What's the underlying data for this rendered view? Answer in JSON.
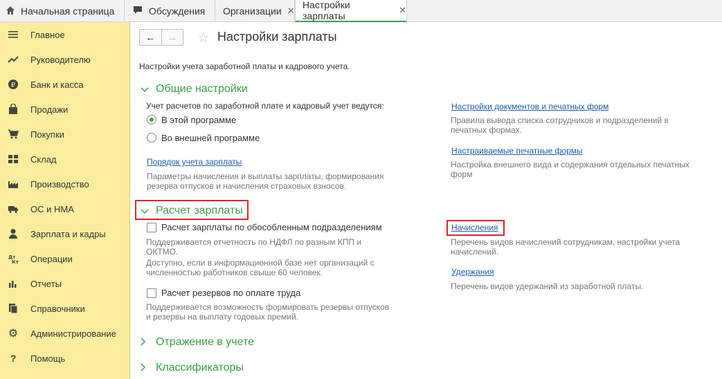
{
  "tabs": [
    {
      "label": "Начальная страница",
      "icon": "home-icon"
    },
    {
      "label": "Обсуждения",
      "icon": "chat-icon"
    },
    {
      "label": "Организации",
      "close": "✕"
    },
    {
      "label": "Настройки зарплаты",
      "close": "✕"
    }
  ],
  "sidebar": {
    "items": [
      {
        "label": "Главное",
        "icon": "menu-lines-icon"
      },
      {
        "label": "Руководителю",
        "icon": "trend-icon"
      },
      {
        "label": "Банк и касса",
        "icon": "ruble-coin-icon"
      },
      {
        "label": "Продажи",
        "icon": "shopping-bag-icon"
      },
      {
        "label": "Покупки",
        "icon": "cart-icon"
      },
      {
        "label": "Склад",
        "icon": "warehouse-grid-icon"
      },
      {
        "label": "Производство",
        "icon": "factory-icon"
      },
      {
        "label": "ОС и НМА",
        "icon": "truck-icon"
      },
      {
        "label": "Зарплата и кадры",
        "icon": "person-icon"
      },
      {
        "label": "Операции",
        "icon": "dt-kt-icon"
      },
      {
        "label": "Отчеты",
        "icon": "bar-chart-icon"
      },
      {
        "label": "Справочники",
        "icon": "books-icon"
      },
      {
        "label": "Администрирование",
        "icon": "gear-icon"
      },
      {
        "label": "Помощь",
        "icon": "question-icon"
      }
    ]
  },
  "header": {
    "title": "Настройки зарплаты",
    "back": "←",
    "forward": "→",
    "star": "☆"
  },
  "subtitle": "Настройки учета заработной платы и кадрового учета.",
  "general": {
    "title": "Общие настройки",
    "question": "Учет расчетов по заработной плате и кадровый учет ведутся:",
    "radio1": "В этой программе",
    "radio2": "Во внешней программе",
    "link1": "Порядок учета зарплаты",
    "note1a": "Параметры начисления и выплаты зарплаты, формирования",
    "note1b": "резерва отпусков и начисления страховых взносов.",
    "rlink1": "Настройки документов и печатных форм",
    "rnote1a": "Правила вывода списка сотрудников и подразделений в",
    "rnote1b": "печатных формах.",
    "rlink2": "Настраиваемые печатные формы",
    "rnote2a": "Настройка внешнего вида и содержания отдельных печатных",
    "rnote2b": "форм"
  },
  "payroll": {
    "title": "Расчет зарплаты",
    "check1": "Расчет зарплаты по обособленным подразделениям",
    "note1a": "Поддерживается отчетность по НДФЛ по разным КПП и",
    "note1b": "ОКТМО.",
    "note1c": "Доступно, если в информационной базе нет организаций с",
    "note1d": "численностью работников свыше 60 человек.",
    "check2": "Расчет резервов по оплате труда",
    "note2a": "Поддерживается возможность формировать резервы отпусков",
    "note2b": "и резервы на выплату годовых премий.",
    "rlink1": "Начисления",
    "rnote1a": "Перечень видов начислений сотрудникам, настройки учета",
    "rnote1b": "начислений.",
    "rlink2": "Удержания",
    "rnote2": "Перечень видов удержаний из заработной платы."
  },
  "section3": "Отражение в учете",
  "section4": "Классификаторы",
  "colors": {
    "accent": "#3aa047",
    "link": "#1e5ea8",
    "highlight": "#d9272e",
    "sidebar": "#fbed9e"
  }
}
